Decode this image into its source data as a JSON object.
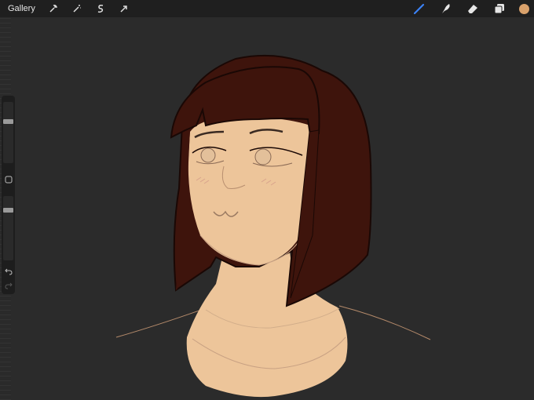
{
  "topbar": {
    "gallery_label": "Gallery",
    "left_tools": [
      "wrench-icon",
      "magic-wand-icon",
      "selection-s-icon",
      "transform-arrow-icon"
    ],
    "right_tools": [
      "brush-icon",
      "smudge-icon",
      "eraser-icon",
      "layers-icon"
    ],
    "active_tool": "brush-icon",
    "current_color": "#d9a16b"
  },
  "sidebar": {
    "brush_size_level": 0.3,
    "opacity_level": 0.2,
    "buttons": [
      "modify-square-icon",
      "undo-icon",
      "redo-icon"
    ]
  },
  "canvas": {
    "colors": {
      "background": "#2b2b2b",
      "hair": "#3e140c",
      "skin": "#edc59a",
      "outline": "#1a0805",
      "sketch": "#c8a183"
    }
  }
}
